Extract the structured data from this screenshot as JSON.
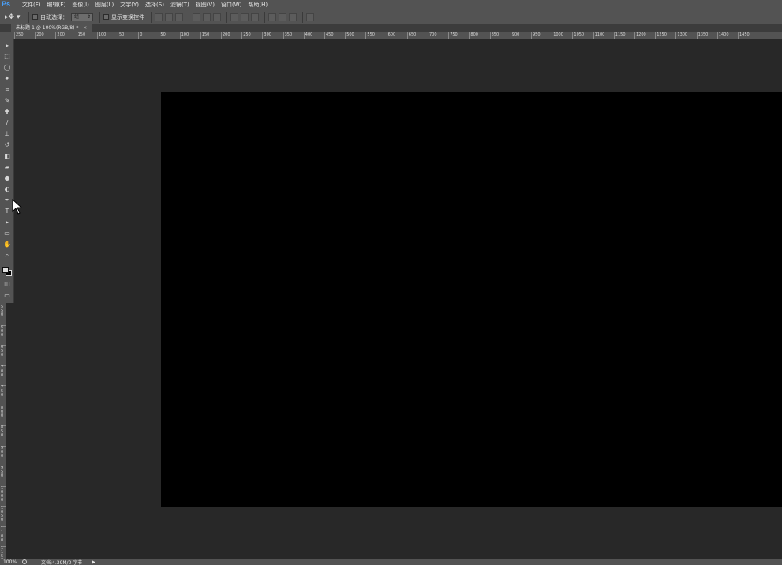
{
  "app": {
    "logo": "Ps"
  },
  "menu": [
    "文件(F)",
    "编辑(E)",
    "图像(I)",
    "图层(L)",
    "文字(Y)",
    "选择(S)",
    "滤镜(T)",
    "视图(V)",
    "窗口(W)",
    "帮助(H)"
  ],
  "options": {
    "auto_select_label": "自动选择：",
    "auto_select_value": "组",
    "show_transform_label": "显示变换控件"
  },
  "document_tab": {
    "title": "未标题-1 @ 100%(RGB/8)",
    "modified": "*",
    "close": "×"
  },
  "ruler_h_labels": [
    "250",
    "200",
    "200",
    "150",
    "100",
    "50",
    "0",
    "50",
    "100",
    "150",
    "200",
    "250",
    "300",
    "350",
    "400",
    "450",
    "500",
    "550",
    "600",
    "650",
    "700",
    "750",
    "800",
    "850",
    "900",
    "950",
    "1000",
    "1050",
    "1100",
    "1150",
    "1200",
    "1250",
    "1300",
    "1350",
    "1400",
    "1450"
  ],
  "ruler_v_labels": [
    "550",
    "600",
    "650",
    "700",
    "750",
    "800",
    "850",
    "900",
    "950",
    "1000",
    "1050",
    "1100",
    "1150"
  ],
  "tools": [
    "move-icon",
    "marquee-icon",
    "lasso-icon",
    "magic-wand-icon",
    "crop-icon",
    "eyedropper-icon",
    "healing-icon",
    "brush-icon",
    "stamp-icon",
    "history-brush-icon",
    "eraser-icon",
    "gradient-icon",
    "blur-icon",
    "dodge-icon",
    "pen-icon",
    "type-icon",
    "path-select-icon",
    "shape-icon",
    "hand-icon",
    "zoom-icon"
  ],
  "colors": {
    "foreground": "#e0e0e0",
    "background": "#000000",
    "canvas": "#000000",
    "workspace": "#282828",
    "panel": "#535353"
  },
  "status": {
    "zoom": "100%",
    "doc": "文档:4.39M/0 字节"
  }
}
